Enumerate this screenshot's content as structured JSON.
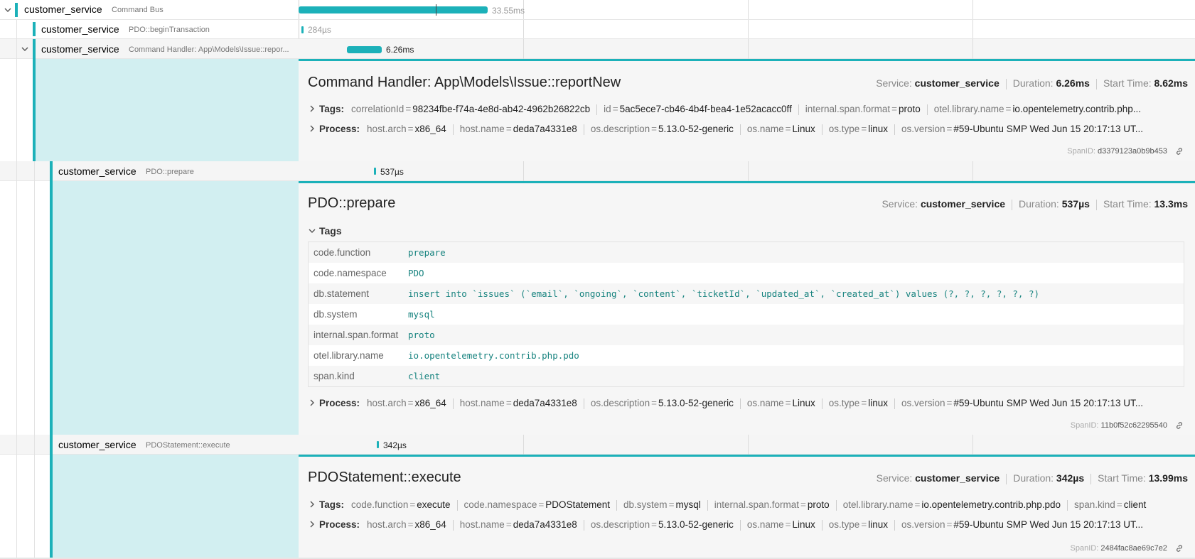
{
  "rows": [
    {
      "service": "customer_service",
      "operation": "Command Bus",
      "duration": "33.55ms"
    },
    {
      "service": "customer_service",
      "operation": "PDO::beginTransaction",
      "duration": "284µs"
    },
    {
      "service": "customer_service",
      "operation": "Command Handler: App\\Models\\Issue::repor...",
      "duration": "6.26ms"
    },
    {
      "service": "customer_service",
      "operation": "PDO::prepare",
      "duration": "537µs"
    },
    {
      "service": "customer_service",
      "operation": "PDOStatement::execute",
      "duration": "342µs"
    }
  ],
  "labels": {
    "service": "Service:",
    "duration": "Duration:",
    "start_time": "Start Time:",
    "tags": "Tags:",
    "tags_header": "Tags",
    "process": "Process:",
    "span_id": "SpanID:"
  },
  "process": [
    {
      "k": "host.arch",
      "v": "x86_64"
    },
    {
      "k": "host.name",
      "v": "deda7a4331e8"
    },
    {
      "k": "os.description",
      "v": "5.13.0-52-generic"
    },
    {
      "k": "os.name",
      "v": "Linux"
    },
    {
      "k": "os.type",
      "v": "linux"
    },
    {
      "k": "os.version",
      "v": "#59-Ubuntu SMP Wed Jun 15 20:17:13 UT..."
    }
  ],
  "details": [
    {
      "title": "Command Handler: App\\Models\\Issue::reportNew",
      "service": "customer_service",
      "duration": "6.26ms",
      "start_time": "8.62ms",
      "tags": [
        {
          "k": "correlationId",
          "v": "98234fbe-f74a-4e8d-ab42-4962b26822cb"
        },
        {
          "k": "id",
          "v": "5ac5ece7-cb46-4b4f-bea4-1e52acacc0ff"
        },
        {
          "k": "internal.span.format",
          "v": "proto"
        },
        {
          "k": "otel.library.name",
          "v": "io.opentelemetry.contrib.php..."
        }
      ],
      "span_id": "d3379123a0b9b453"
    },
    {
      "title": "PDO::prepare",
      "service": "customer_service",
      "duration": "537µs",
      "start_time": "13.3ms",
      "tags": [
        {
          "k": "code.function",
          "v": "prepare"
        },
        {
          "k": "code.namespace",
          "v": "PDO"
        },
        {
          "k": "db.statement",
          "v": "insert into `issues` (`email`, `ongoing`, `content`, `ticketId`, `updated_at`, `created_at`) values (?, ?, ?, ?, ?, ?)"
        },
        {
          "k": "db.system",
          "v": "mysql"
        },
        {
          "k": "internal.span.format",
          "v": "proto"
        },
        {
          "k": "otel.library.name",
          "v": "io.opentelemetry.contrib.php.pdo"
        },
        {
          "k": "span.kind",
          "v": "client"
        }
      ],
      "span_id": "11b0f52c62295540"
    },
    {
      "title": "PDOStatement::execute",
      "service": "customer_service",
      "duration": "342µs",
      "start_time": "13.99ms",
      "tags": [
        {
          "k": "code.function",
          "v": "execute"
        },
        {
          "k": "code.namespace",
          "v": "PDOStatement"
        },
        {
          "k": "db.system",
          "v": "mysql"
        },
        {
          "k": "internal.span.format",
          "v": "proto"
        },
        {
          "k": "otel.library.name",
          "v": "io.opentelemetry.contrib.php.pdo"
        },
        {
          "k": "span.kind",
          "v": "client"
        }
      ],
      "span_id": "2484fac8ae69c7e2"
    }
  ],
  "colors": {
    "accent": "#1cb1b9",
    "tint": "#d2eff1",
    "tag_value": "#17837f"
  }
}
